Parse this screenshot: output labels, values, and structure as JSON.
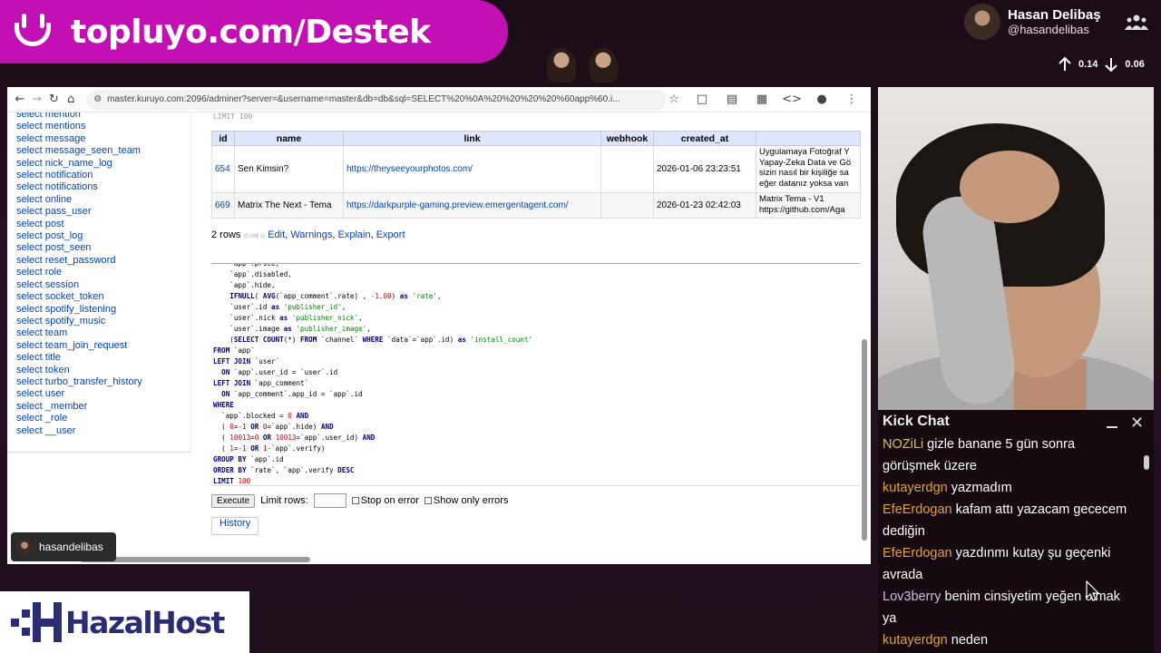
{
  "banner": {
    "text": "topluyo.com/Destek"
  },
  "profile": {
    "name": "Hasan Delibaş",
    "handle": "@hasandelibas",
    "upload": "0.14",
    "download": "0.06"
  },
  "browser": {
    "url": "master.kuruyo.com:2096/adminer?server=&username=master&db=db&sql=SELECT%20%0A%20%20%20%20%60app%60.i..."
  },
  "sidebar": {
    "items": [
      "select mention",
      "select mentions",
      "select message",
      "select message_seen_team",
      "select nick_name_log",
      "select notification",
      "select notifications",
      "select online",
      "select pass_user",
      "select post",
      "select post_log",
      "select post_seen",
      "select reset_password",
      "select role",
      "select session",
      "select socket_token",
      "select spotify_listening",
      "select spotify_music",
      "select team",
      "select team_join_request",
      "select title",
      "select token",
      "select turbo_transfer_history",
      "select user",
      "select _member",
      "select _role",
      "select __user"
    ]
  },
  "results": {
    "cut_text": "LIMIT 100",
    "columns": [
      "id",
      "name",
      "link",
      "webhook",
      "created_at",
      ""
    ],
    "rows": [
      {
        "id": "654",
        "name": "Sen Kimsin?",
        "link": "https://theyseeyourphotos.com/",
        "webhook": "",
        "created_at": "2026-01-06 23:23:51",
        "desc": "Uygulamaya Fotoğraf Y\nYapay-Zeka Data ve Gö\nsizin nasıl bir kişiliğe sa\neğer datanız yoksa van"
      },
      {
        "id": "669",
        "name": "Matrix The Next - Tema",
        "link": "https://darkpurple-gaming.preview.emergentagent.com/",
        "webhook": "",
        "created_at": "2026-01-23 02:42:03",
        "desc": "Matrix Tema - V1\nhttps://github.com/Aga"
      }
    ],
    "count_text": "2 rows",
    "time_text": "(0.046 s)",
    "actions": [
      "Edit",
      "Warnings",
      "Explain",
      "Export"
    ]
  },
  "query": {
    "execute_label": "Execute",
    "limit_label": "Limit rows:",
    "stop_label": "Stop on error",
    "only_errors_label": "Show only errors",
    "history_label": "History"
  },
  "user_chip": {
    "name": "hasandelibas"
  },
  "chat": {
    "title": "Kick Chat",
    "messages": [
      {
        "user": "NOZiLi",
        "color": "#d8c15a",
        "text": "gizle banane 5 gün sonra görüşmek üzere"
      },
      {
        "user": "kutayerdgn",
        "color": "#e2a13c",
        "text": "yazmadım"
      },
      {
        "user": "EfeErdogan",
        "color": "#e2a13c",
        "text": "kafam attı yazacam gececem dediğin"
      },
      {
        "user": "EfeErdogan",
        "color": "#e2a13c",
        "text": "yazdınmı kutay şu geçenki avrada"
      },
      {
        "user": "Lov3berry",
        "color": "#d8b8e8",
        "text": "benim cinsiyetim yeğen olmak ya"
      },
      {
        "user": "kutayerdgn",
        "color": "#e2a13c",
        "text": "neden"
      }
    ]
  },
  "logo": {
    "text": "HazalHost"
  }
}
